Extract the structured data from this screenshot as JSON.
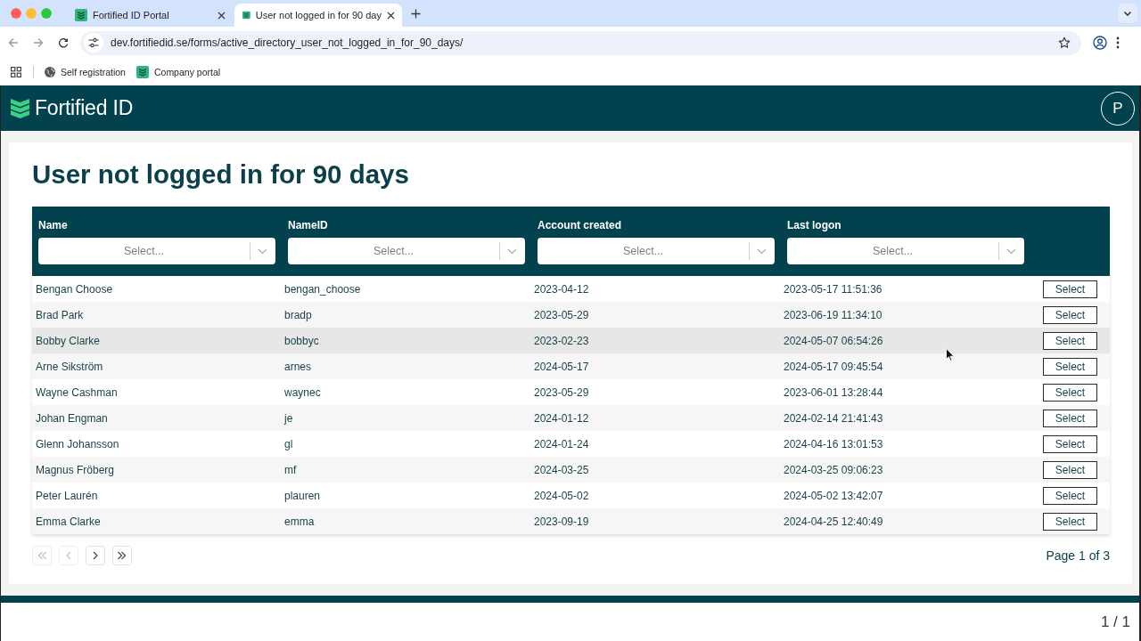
{
  "browser": {
    "tabs": [
      {
        "title": "Fortified ID Portal",
        "selected": false
      },
      {
        "title": "User not logged in for 90 day",
        "selected": true
      }
    ],
    "url": "dev.fortifiedid.se/forms/active_directory_user_not_logged_in_for_90_days/",
    "bookmarks": [
      {
        "label": "Self registration",
        "kind": "globe"
      },
      {
        "label": "Company portal",
        "kind": "site"
      }
    ]
  },
  "header": {
    "brand": "Fortified ID",
    "avatar": "P"
  },
  "page": {
    "title": "User not logged in for 90 days"
  },
  "table": {
    "columns": [
      {
        "label": "Name",
        "placeholder": "Select..."
      },
      {
        "label": "NameID",
        "placeholder": "Select..."
      },
      {
        "label": "Account created",
        "placeholder": "Select..."
      },
      {
        "label": "Last logon",
        "placeholder": "Select..."
      }
    ],
    "rows": [
      {
        "cells": [
          "Bengan Choose",
          "bengan_choose",
          "2023-04-12",
          "2023-05-17 11:51:36"
        ],
        "action": "Select",
        "hovered": false
      },
      {
        "cells": [
          "Brad Park",
          "bradp",
          "2023-05-29",
          "2023-06-19 11:34:10"
        ],
        "action": "Select",
        "hovered": false
      },
      {
        "cells": [
          "Bobby Clarke",
          "bobbyc",
          "2023-02-23",
          "2024-05-07 06:54:26"
        ],
        "action": "Select",
        "hovered": true
      },
      {
        "cells": [
          "Arne Sikström",
          "arnes",
          "2024-05-17",
          "2024-05-17 09:45:54"
        ],
        "action": "Select",
        "hovered": false
      },
      {
        "cells": [
          "Wayne Cashman",
          "waynec",
          "2023-05-29",
          "2023-06-01 13:28:44"
        ],
        "action": "Select",
        "hovered": false
      },
      {
        "cells": [
          "Johan Engman",
          "je",
          "2024-01-12",
          "2024-02-14 21:41:43"
        ],
        "action": "Select",
        "hovered": false
      },
      {
        "cells": [
          "Glenn Johansson",
          "gl",
          "2024-01-24",
          "2024-04-16 13:01:53"
        ],
        "action": "Select",
        "hovered": false
      },
      {
        "cells": [
          "Magnus Fröberg",
          "mf",
          "2024-03-25",
          "2024-03-25 09:06:23"
        ],
        "action": "Select",
        "hovered": false
      },
      {
        "cells": [
          "Peter Laurén",
          "plauren",
          "2024-05-02",
          "2024-05-02 13:42:07"
        ],
        "action": "Select",
        "hovered": false
      },
      {
        "cells": [
          "Emma Clarke",
          "emma",
          "2023-09-19",
          "2024-04-25 12:40:49"
        ],
        "action": "Select",
        "hovered": false
      }
    ],
    "pager": {
      "buttons": [
        {
          "kind": "first",
          "disabled": true
        },
        {
          "kind": "prev",
          "disabled": true
        },
        {
          "kind": "next",
          "disabled": false
        },
        {
          "kind": "last",
          "disabled": false
        }
      ],
      "status": "Page 1 of 3"
    }
  },
  "footer": {
    "page_counter": "1 / 1"
  }
}
